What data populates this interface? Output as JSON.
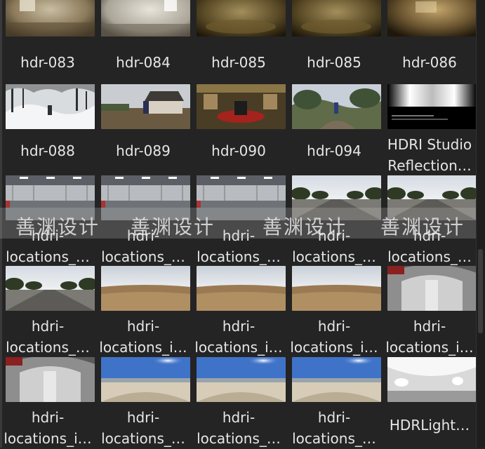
{
  "rows": [
    [
      {
        "label": "hdr-083",
        "thumb": "interior-sepia"
      },
      {
        "label": "hdr-084",
        "thumb": "interior-grey"
      },
      {
        "label": "hdr-085",
        "thumb": "interior-warm"
      },
      {
        "label": "hdr-085",
        "thumb": "interior-warm"
      },
      {
        "label": "hdr-086",
        "thumb": "interior-warm2"
      }
    ],
    [
      {
        "label": "hdr-088",
        "thumb": "snow"
      },
      {
        "label": "hdr-089",
        "thumb": "house"
      },
      {
        "label": "hdr-090",
        "thumb": "room-red"
      },
      {
        "label": "hdr-094",
        "thumb": "garden"
      },
      {
        "label": "HDRI Studio\nReflection…",
        "thumb": "studio"
      }
    ],
    [
      {
        "label": "hdri-\nlocations_…",
        "thumb": "garage"
      },
      {
        "label": "hdri-\nlocations_…",
        "thumb": "garage"
      },
      {
        "label": "hdri-\nlocations_…",
        "thumb": "garage"
      },
      {
        "label": "hdri-\nlocations_…",
        "thumb": "road"
      },
      {
        "label": "hdri-\nlocations_…",
        "thumb": "road"
      }
    ],
    [
      {
        "label": "hdri-\nlocations_…",
        "thumb": "road"
      },
      {
        "label": "hdri-\nlocations_i…",
        "thumb": "desert"
      },
      {
        "label": "hdri-\nlocations_i…",
        "thumb": "desert"
      },
      {
        "label": "hdri-\nlocations_i…",
        "thumb": "desert"
      },
      {
        "label": "hdri-\nlocations_i…",
        "thumb": "tunnel"
      }
    ],
    [
      {
        "label": "hdri-\nlocations_i…",
        "thumb": "tunnel"
      },
      {
        "label": "hdri-\nlocations_…",
        "thumb": "beach"
      },
      {
        "label": "hdri-\nlocations_…",
        "thumb": "beach"
      },
      {
        "label": "hdri-\nlocations_…",
        "thumb": "beach"
      },
      {
        "label": "HDRLight…",
        "thumb": "light"
      }
    ]
  ],
  "watermark": "善渊设计"
}
